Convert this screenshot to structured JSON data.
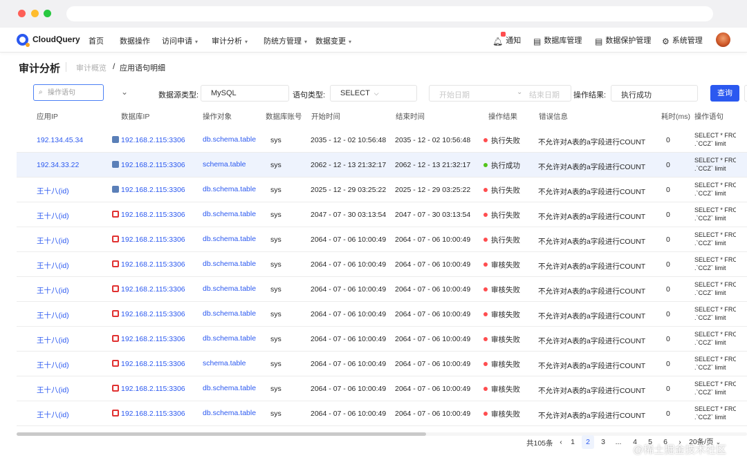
{
  "nav": {
    "brand": "CloudQuery",
    "items": [
      {
        "label": "首页",
        "caret": false
      },
      {
        "label": "数据操作",
        "caret": false
      },
      {
        "label": "访问申请",
        "caret": true
      },
      {
        "label": "审计分析",
        "caret": true
      },
      {
        "label": "防统方管理",
        "caret": true
      },
      {
        "label": "数据变更",
        "caret": true
      }
    ],
    "right": {
      "notify": "通知",
      "db_manage": "数据库管理",
      "data_protect": "数据保护管理",
      "system": "系统管理"
    }
  },
  "header": {
    "title": "审计分析",
    "breadcrumb_parent": "审计概览",
    "breadcrumb_sep": "/",
    "breadcrumb_current": "应用语句明细"
  },
  "filters": {
    "search_placeholder": "操作语句",
    "datasource_label": "数据源类型:",
    "datasource_value": "MySQL",
    "stmt_type_label": "语句类型:",
    "stmt_type_value": "SELECT",
    "start_placeholder": "开始日期",
    "end_placeholder": "结束日期",
    "result_label": "操作结果:",
    "result_value": "执行成功",
    "query_label": "查询"
  },
  "table": {
    "headers": {
      "app_ip": "应用IP",
      "db_ip": "数据库IP",
      "target": "操作对象",
      "account": "数据库账号",
      "start": "开始时间",
      "end": "结束时间",
      "result": "操作结果",
      "error": "错误信息",
      "duration": "耗时(ms)",
      "stmt": "操作语句"
    },
    "rows": [
      {
        "app": "192.134.45.34",
        "db": "192.168.2.115:3306",
        "db_type": "mysql",
        "target": "db.schema.table",
        "account": "sys",
        "start": "2035 - 12 - 02 10:56:48",
        "end": "2035 - 12 - 02 10:56:48",
        "result": "执行失败",
        "status": "fail",
        "error": "不允许对A表的a字段进行COUNT",
        "ms": "0",
        "stmt1": "SELECT * FRO",
        "stmt2": ".`CCZ` limit"
      },
      {
        "app": "192.34.33.22",
        "db": "192.168.2.115:3306",
        "db_type": "mysql",
        "target": "schema.table",
        "account": "sys",
        "start": "2062 - 12 - 13 21:32:17",
        "end": "2062 - 12 - 13 21:32:17",
        "result": "执行成功",
        "status": "success",
        "error": "不允许对A表的a字段进行COUNT",
        "ms": "0",
        "stmt1": "SELECT * FRO",
        "stmt2": ".`CCZ` limit"
      },
      {
        "app": "王十八(id)",
        "db": "192.168.2.115:3306",
        "db_type": "mysql",
        "target": "db.schema.table",
        "account": "sys",
        "start": "2025 - 12 - 29 03:25:22",
        "end": "2025 - 12 - 29 03:25:22",
        "result": "执行失败",
        "status": "fail",
        "error": "不允许对A表的a字段进行COUNT",
        "ms": "0",
        "stmt1": "SELECT * FRO",
        "stmt2": ".`CCZ` limit"
      },
      {
        "app": "王十八(id)",
        "db": "192.168.2.115:3306",
        "db_type": "oracle",
        "target": "db.schema.table",
        "account": "sys",
        "start": "2047 - 07 - 30 03:13:54",
        "end": "2047 - 07 - 30 03:13:54",
        "result": "执行失败",
        "status": "fail",
        "error": "不允许对A表的a字段进行COUNT",
        "ms": "0",
        "stmt1": "SELECT * FRO",
        "stmt2": ".`CCZ` limit"
      },
      {
        "app": "王十八(id)",
        "db": "192.168.2.115:3306",
        "db_type": "oracle",
        "target": "db.schema.table",
        "account": "sys",
        "start": "2064 - 07 - 06 10:00:49",
        "end": "2064 - 07 - 06 10:00:49",
        "result": "执行失败",
        "status": "fail",
        "error": "不允许对A表的a字段进行COUNT",
        "ms": "0",
        "stmt1": "SELECT * FRO",
        "stmt2": ".`CCZ` limit"
      },
      {
        "app": "王十八(id)",
        "db": "192.168.2.115:3306",
        "db_type": "oracle",
        "target": "db.schema.table",
        "account": "sys",
        "start": "2064 - 07 - 06 10:00:49",
        "end": "2064 - 07 - 06 10:00:49",
        "result": "审核失败",
        "status": "fail",
        "error": "不允许对A表的a字段进行COUNT",
        "ms": "0",
        "stmt1": "SELECT * FRO",
        "stmt2": ".`CCZ` limit"
      },
      {
        "app": "王十八(id)",
        "db": "192.168.2.115:3306",
        "db_type": "oracle",
        "target": "db.schema.table",
        "account": "sys",
        "start": "2064 - 07 - 06 10:00:49",
        "end": "2064 - 07 - 06 10:00:49",
        "result": "审核失败",
        "status": "fail",
        "error": "不允许对A表的a字段进行COUNT",
        "ms": "0",
        "stmt1": "SELECT * FRO",
        "stmt2": ".`CCZ` limit"
      },
      {
        "app": "王十八(id)",
        "db": "192.168.2.115:3306",
        "db_type": "oracle",
        "target": "db.schema.table",
        "account": "sys",
        "start": "2064 - 07 - 06 10:00:49",
        "end": "2064 - 07 - 06 10:00:49",
        "result": "审核失败",
        "status": "fail",
        "error": "不允许对A表的a字段进行COUNT",
        "ms": "0",
        "stmt1": "SELECT * FRO",
        "stmt2": ".`CCZ` limit"
      },
      {
        "app": "王十八(id)",
        "db": "192.168.2.115:3306",
        "db_type": "oracle",
        "target": "db.schema.table",
        "account": "sys",
        "start": "2064 - 07 - 06 10:00:49",
        "end": "2064 - 07 - 06 10:00:49",
        "result": "审核失败",
        "status": "fail",
        "error": "不允许对A表的a字段进行COUNT",
        "ms": "0",
        "stmt1": "SELECT * FRO",
        "stmt2": ".`CCZ` limit"
      },
      {
        "app": "王十八(id)",
        "db": "192.168.2.115:3306",
        "db_type": "oracle",
        "target": "schema.table",
        "account": "sys",
        "start": "2064 - 07 - 06 10:00:49",
        "end": "2064 - 07 - 06 10:00:49",
        "result": "审核失败",
        "status": "fail",
        "error": "不允许对A表的a字段进行COUNT",
        "ms": "0",
        "stmt1": "SELECT * FRO",
        "stmt2": ".`CCZ` limit"
      },
      {
        "app": "王十八(id)",
        "db": "192.168.2.115:3306",
        "db_type": "oracle",
        "target": "db.schema.table",
        "account": "sys",
        "start": "2064 - 07 - 06 10:00:49",
        "end": "2064 - 07 - 06 10:00:49",
        "result": "审核失败",
        "status": "fail",
        "error": "不允许对A表的a字段进行COUNT",
        "ms": "0",
        "stmt1": "SELECT * FRO",
        "stmt2": ".`CCZ` limit"
      },
      {
        "app": "王十八(id)",
        "db": "192.168.2.115:3306",
        "db_type": "oracle",
        "target": "db.schema.table",
        "account": "sys",
        "start": "2064 - 07 - 06 10:00:49",
        "end": "2064 - 07 - 06 10:00:49",
        "result": "审核失败",
        "status": "fail",
        "error": "不允许对A表的a字段进行COUNT",
        "ms": "0",
        "stmt1": "SELECT * FRO",
        "stmt2": ".`CCZ` limit"
      }
    ]
  },
  "pagination": {
    "total": "共105条",
    "pages": [
      "1",
      "2",
      "3",
      "...",
      "4",
      "5",
      "6"
    ],
    "active_page": "2",
    "page_size": "20条/页"
  },
  "watermark": "@稀土掘金技术社区",
  "colors": {
    "accent": "#2b59f0",
    "fail": "#ff4d4f",
    "success": "#52c41a",
    "selected_row": "#eef3fd"
  }
}
